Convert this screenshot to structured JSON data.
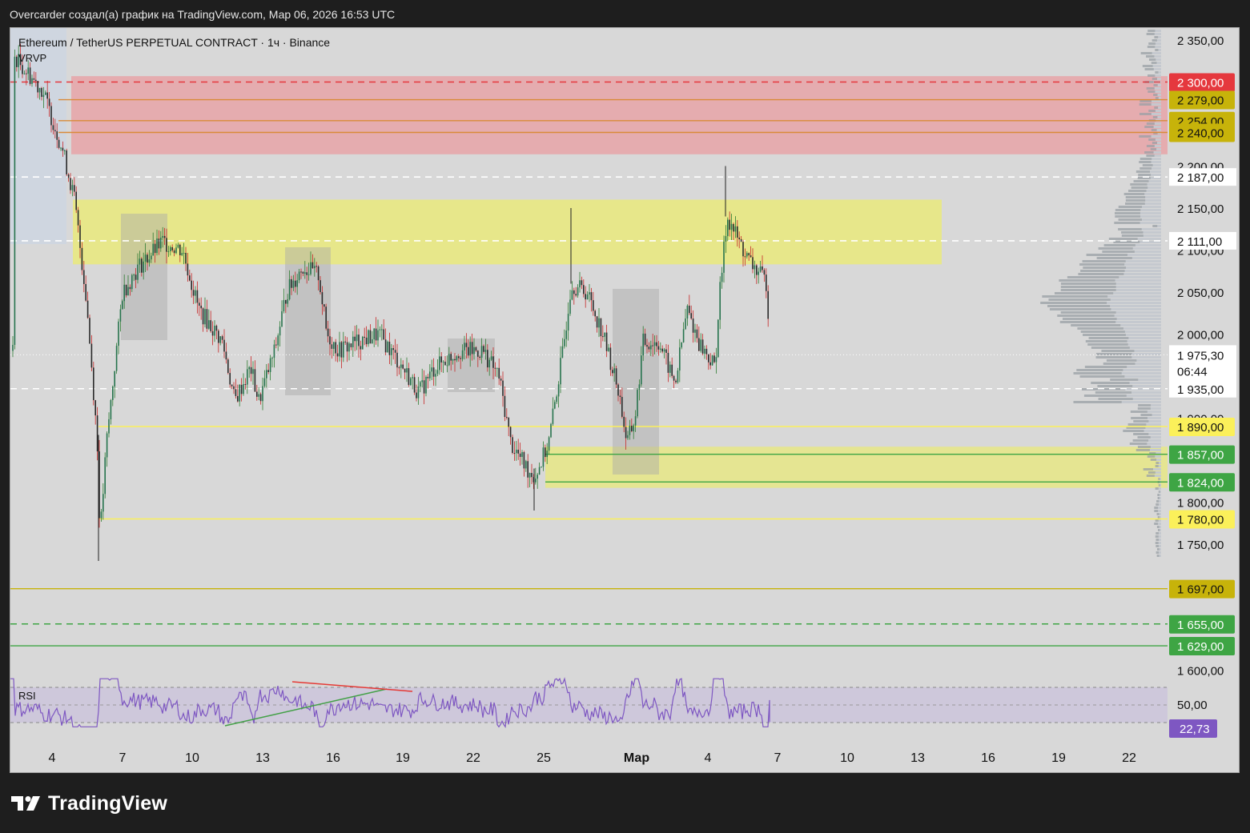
{
  "header": {
    "text": "Overcarder создал(а) график на TradingView.com, Мар 06, 2026 16:53 UTC"
  },
  "legend": {
    "title": "Ethereum / TetherUS PERPETUAL CONTRACT · 1ч · Binance",
    "indicator": "VRVP",
    "rsi_label": "RSI"
  },
  "logo": {
    "text": "TradingView",
    "icon": "tradingview-logo-icon"
  },
  "colors": {
    "background": "#d8d8d8",
    "red_zone": "#e8a4a8",
    "yellow_zone": "#e8e886",
    "red_marker": "#e5383e",
    "gold_marker": "#c7b30a",
    "yellow_marker": "#fbf05a",
    "green_marker": "#3ea544",
    "rsi_line": "#7e57c2",
    "rsi_marker": "#7e57c2"
  },
  "price_axis": {
    "labels": [
      "2 350,00",
      "2 200,00",
      "2 150,00",
      "2 100,00",
      "2 050,00",
      "2 000,00",
      "1 900,00",
      "1 800,00",
      "1 750,00",
      "1 600,00"
    ]
  },
  "time_axis": {
    "labels": [
      "4",
      "7",
      "10",
      "13",
      "16",
      "19",
      "22",
      "25",
      "Мар",
      "4",
      "7",
      "10",
      "13",
      "16",
      "19",
      "22"
    ]
  },
  "price_markers": [
    {
      "value": 2300,
      "label": "2 300,00",
      "style": "red"
    },
    {
      "value": 2279,
      "label": "2 279,00",
      "style": "gold"
    },
    {
      "value": 2254,
      "label": "2 254,00",
      "style": "gold"
    },
    {
      "value": 2240,
      "label": "2 240,00",
      "style": "gold"
    },
    {
      "value": 2187,
      "label": "2 187,00",
      "style": "white"
    },
    {
      "value": 2111,
      "label": "2 111,00",
      "style": "white"
    },
    {
      "value": 1975.3,
      "label": "1 975,30",
      "sublabel": "06:44",
      "style": "current"
    },
    {
      "value": 1935,
      "label": "1 935,00",
      "style": "white"
    },
    {
      "value": 1890,
      "label": "1 890,00",
      "style": "yellow"
    },
    {
      "value": 1857,
      "label": "1 857,00",
      "style": "green"
    },
    {
      "value": 1824,
      "label": "1 824,00",
      "style": "green"
    },
    {
      "value": 1780,
      "label": "1 780,00",
      "style": "yellow"
    },
    {
      "value": 1697,
      "label": "1 697,00",
      "style": "gold"
    },
    {
      "value": 1655,
      "label": "1 655,00",
      "style": "green"
    },
    {
      "value": 1629,
      "label": "1 629,00",
      "style": "green"
    }
  ],
  "rsi": {
    "axis_label": "50,00",
    "value_label": "22,73",
    "value": 22.73
  },
  "chart_data": {
    "type": "candlestick",
    "title": "Ethereum / TetherUS PERPETUAL CONTRACT · 1ч · Binance",
    "ylim": [
      1560,
      2370
    ],
    "zones": [
      {
        "name": "red supply zone",
        "from": 2214,
        "to": 2307
      },
      {
        "name": "yellow zone upper",
        "from": 2083,
        "to": 2160
      },
      {
        "name": "yellow zone lower",
        "from": 1817,
        "to": 1866
      }
    ],
    "horizontal_levels": [
      2300,
      2279,
      2254,
      2240,
      2187,
      2111,
      1935,
      1890,
      1857,
      1824,
      1780,
      1697,
      1655,
      1629
    ],
    "last_price": 1975.3,
    "rsi_last": 22.73
  }
}
